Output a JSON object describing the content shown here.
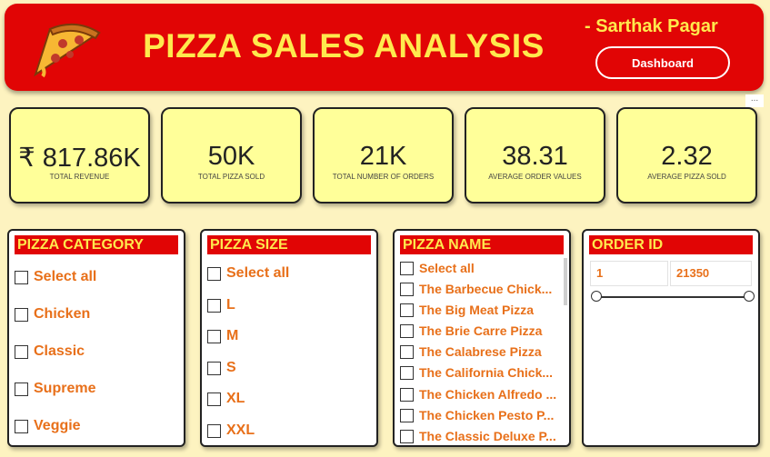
{
  "header": {
    "title": "PIZZA SALES ANALYSIS",
    "author": "- Sarthak Pagar",
    "button_label": "Dashboard",
    "colors": {
      "banner": "#e10505",
      "title": "#ffe94d"
    },
    "icon": "pizza-slice-icon"
  },
  "more_options": "...",
  "kpis": [
    {
      "value": "₹ 817.86K",
      "label": "TOTAL REVENUE"
    },
    {
      "value": "50K",
      "label": "TOTAL PIZZA SOLD"
    },
    {
      "value": "21K",
      "label": "TOTAL NUMBER OF ORDERS"
    },
    {
      "value": "38.31",
      "label": "AVERAGE ORDER VALUES"
    },
    {
      "value": "2.32",
      "label": "AVERAGE PIZZA SOLD"
    }
  ],
  "filters": {
    "category": {
      "title": "PIZZA CATEGORY",
      "items": [
        "Select all",
        "Chicken",
        "Classic",
        "Supreme",
        "Veggie"
      ]
    },
    "size": {
      "title": "PIZZA SIZE",
      "items": [
        "Select all",
        "L",
        "M",
        "S",
        "XL",
        "XXL"
      ]
    },
    "name": {
      "title": "PIZZA NAME",
      "items": [
        "Select all",
        "The Barbecue Chick...",
        "The Big Meat Pizza",
        "The Brie Carre Pizza",
        "The Calabrese Pizza",
        "The California Chick...",
        "The Chicken Alfredo ...",
        "The Chicken Pesto P...",
        "The Classic Deluxe P..."
      ]
    },
    "order_id": {
      "title": "ORDER ID",
      "min": "1",
      "max": "21350"
    }
  }
}
